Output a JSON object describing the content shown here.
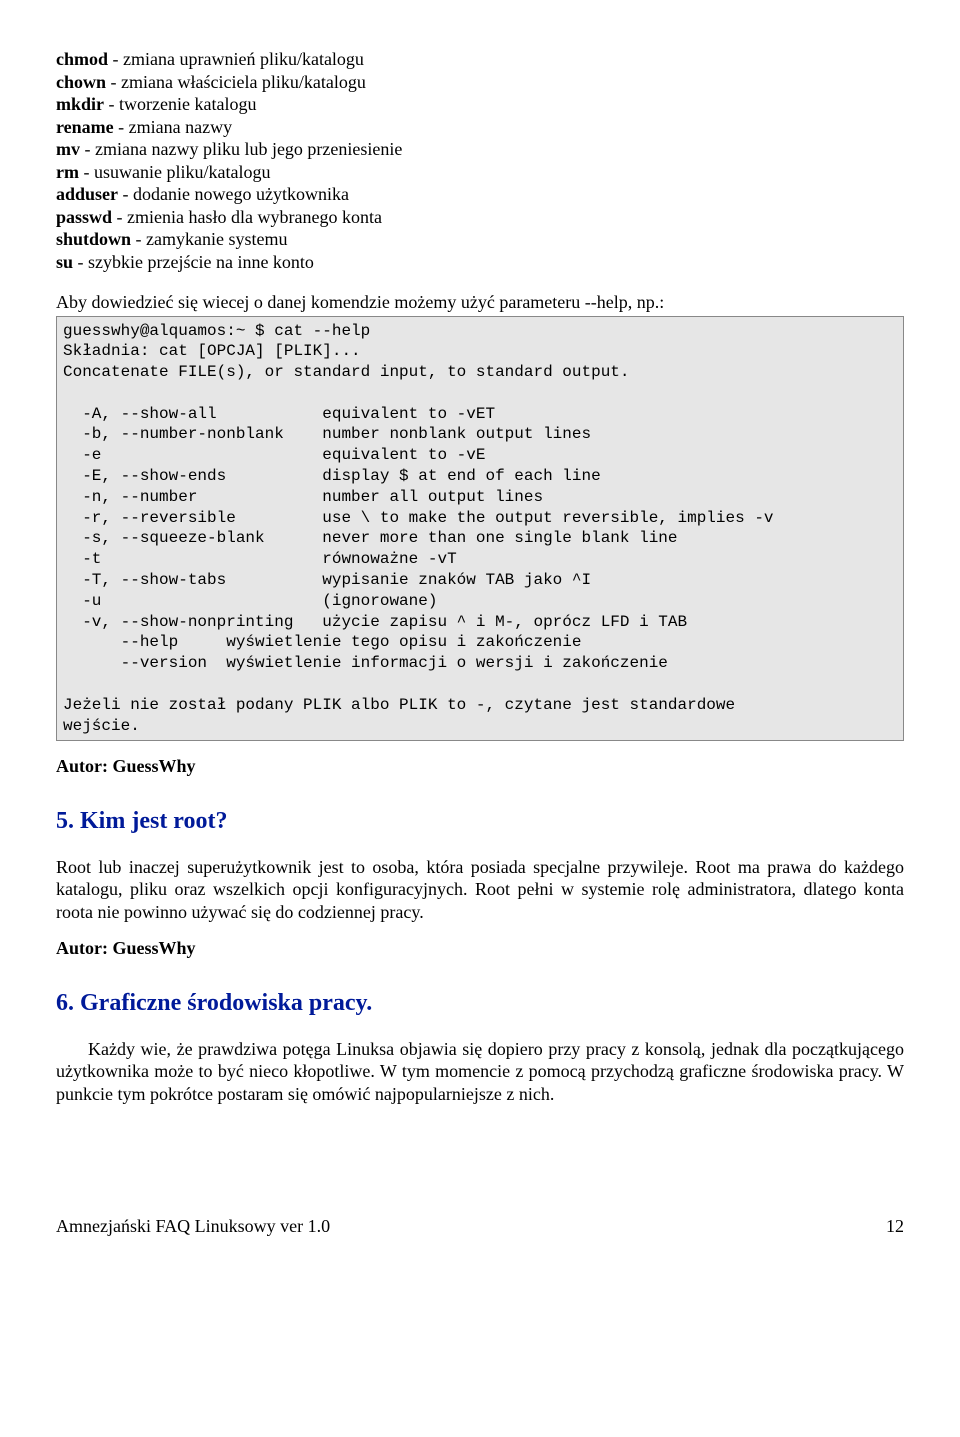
{
  "commands": [
    {
      "cmd": "chmod",
      "desc": " - zmiana uprawnień pliku/katalogu"
    },
    {
      "cmd": "chown",
      "desc": " - zmiana właściciela pliku/katalogu"
    },
    {
      "cmd": "mkdir",
      "desc": " - tworzenie katalogu"
    },
    {
      "cmd": "rename",
      "desc": " - zmiana nazwy"
    },
    {
      "cmd": "mv",
      "desc": " - zmiana nazwy pliku lub jego przeniesienie"
    },
    {
      "cmd": "rm",
      "desc": " - usuwanie pliku/katalogu"
    },
    {
      "cmd": "adduser",
      "desc": " - dodanie nowego użytkownika"
    },
    {
      "cmd": "passwd",
      "desc": " - zmienia hasło dla wybranego konta"
    },
    {
      "cmd": "shutdown",
      "desc": " - zamykanie systemu"
    },
    {
      "cmd": "su",
      "desc": " - szybkie przejście na inne konto"
    }
  ],
  "help_intro": "Aby dowiedzieć się wiecej o danej komendzie możemy użyć parameteru --help, np.:",
  "code_block": "guesswhy@alquamos:~ $ cat --help\nSkładnia: cat [OPCJA] [PLIK]...\nConcatenate FILE(s), or standard input, to standard output.\n\n  -A, --show-all           equivalent to -vET\n  -b, --number-nonblank    number nonblank output lines\n  -e                       equivalent to -vE\n  -E, --show-ends          display $ at end of each line\n  -n, --number             number all output lines\n  -r, --reversible         use \\ to make the output reversible, implies -v\n  -s, --squeeze-blank      never more than one single blank line\n  -t                       równoważne -vT\n  -T, --show-tabs          wypisanie znaków TAB jako ^I\n  -u                       (ignorowane)\n  -v, --show-nonprinting   użycie zapisu ^ i M-, oprócz LFD i TAB\n      --help     wyświetlenie tego opisu i zakończenie\n      --version  wyświetlenie informacji o wersji i zakończenie\n\nJeżeli nie został podany PLIK albo PLIK to -, czytane jest standardowe\nwejście.",
  "author_label": "Autor:",
  "author_name": " GuessWhy",
  "section5": {
    "heading": "5. Kim jest root?",
    "text": "Root lub inaczej superużytkownik jest to osoba, która posiada specjalne przywileje. Root ma prawa do każdego katalogu, pliku oraz wszelkich opcji konfiguracyjnych. Root pełni w systemie rolę administratora, dlatego konta roota nie powinno używać się do codziennej pracy."
  },
  "section6": {
    "heading": "6. Graficzne środowiska pracy.",
    "text": "Każdy wie, że prawdziwa potęga Linuksa objawia się dopiero przy pracy z konsolą, jednak dla początkującego użytkownika może to być nieco kłopotliwe. W tym momencie z pomocą przychodzą graficzne środowiska pracy. W punkcie tym pokrótce postaram się omówić najpopularniejsze z nich."
  },
  "footer": {
    "left": "Amnezjański FAQ Linuksowy ver 1.0",
    "right": "12"
  }
}
